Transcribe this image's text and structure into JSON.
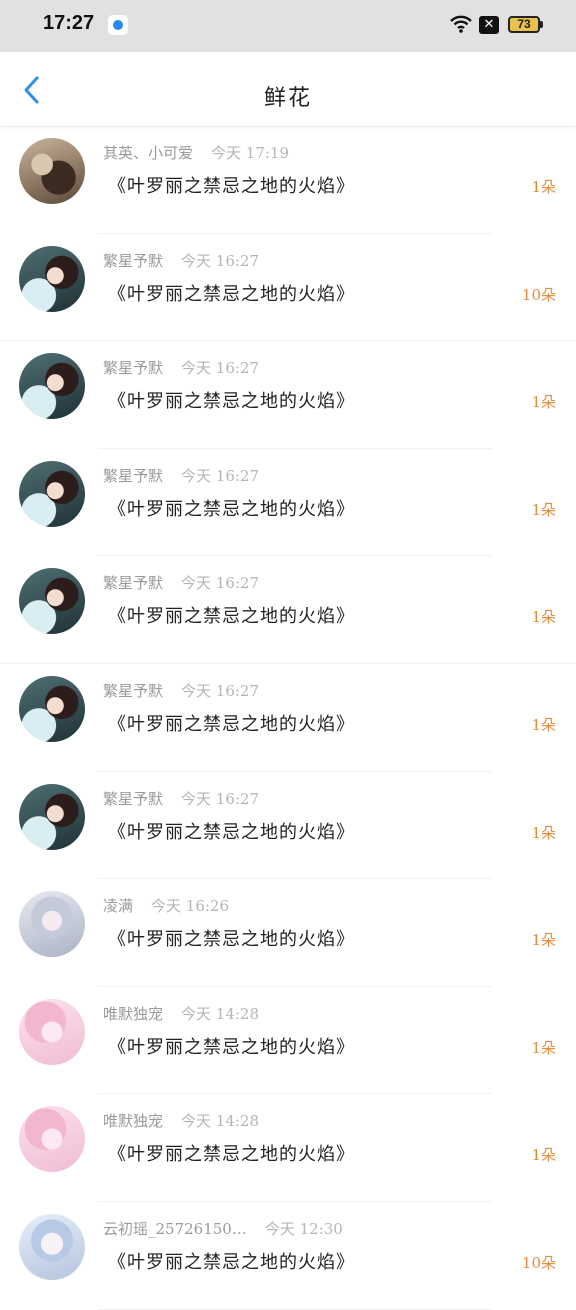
{
  "status_bar": {
    "time": "17:27",
    "close_badge": "✕",
    "battery": "73"
  },
  "nav": {
    "title": "鲜花"
  },
  "items": [
    {
      "name": "其英、小可爱",
      "time": "今天 17:19",
      "gift": "《叶罗丽之禁忌之地的火焰》",
      "count": "1朵",
      "avatar": "a0"
    },
    {
      "name": "繁星予默",
      "time": "今天 16:27",
      "gift": "《叶罗丽之禁忌之地的火焰》",
      "count": "10朵",
      "avatar": "a1"
    },
    {
      "name": "繁星予默",
      "time": "今天 16:27",
      "gift": "《叶罗丽之禁忌之地的火焰》",
      "count": "1朵",
      "avatar": "a1"
    },
    {
      "name": "繁星予默",
      "time": "今天 16:27",
      "gift": "《叶罗丽之禁忌之地的火焰》",
      "count": "1朵",
      "avatar": "a1"
    },
    {
      "name": "繁星予默",
      "time": "今天 16:27",
      "gift": "《叶罗丽之禁忌之地的火焰》",
      "count": "1朵",
      "avatar": "a1"
    },
    {
      "name": "繁星予默",
      "time": "今天 16:27",
      "gift": "《叶罗丽之禁忌之地的火焰》",
      "count": "1朵",
      "avatar": "a1"
    },
    {
      "name": "繁星予默",
      "time": "今天 16:27",
      "gift": "《叶罗丽之禁忌之地的火焰》",
      "count": "1朵",
      "avatar": "a1"
    },
    {
      "name": "凌满",
      "time": "今天 16:26",
      "gift": "《叶罗丽之禁忌之地的火焰》",
      "count": "1朵",
      "avatar": "a2"
    },
    {
      "name": "唯默独宠",
      "time": "今天 14:28",
      "gift": "《叶罗丽之禁忌之地的火焰》",
      "count": "1朵",
      "avatar": "a3"
    },
    {
      "name": "唯默独宠",
      "time": "今天 14:28",
      "gift": "《叶罗丽之禁忌之地的火焰》",
      "count": "1朵",
      "avatar": "a3"
    },
    {
      "name": "云初瑶_25726150…",
      "time": "今天 12:30",
      "gift": "《叶罗丽之禁忌之地的火焰》",
      "count": "10朵",
      "avatar": "a4"
    }
  ]
}
